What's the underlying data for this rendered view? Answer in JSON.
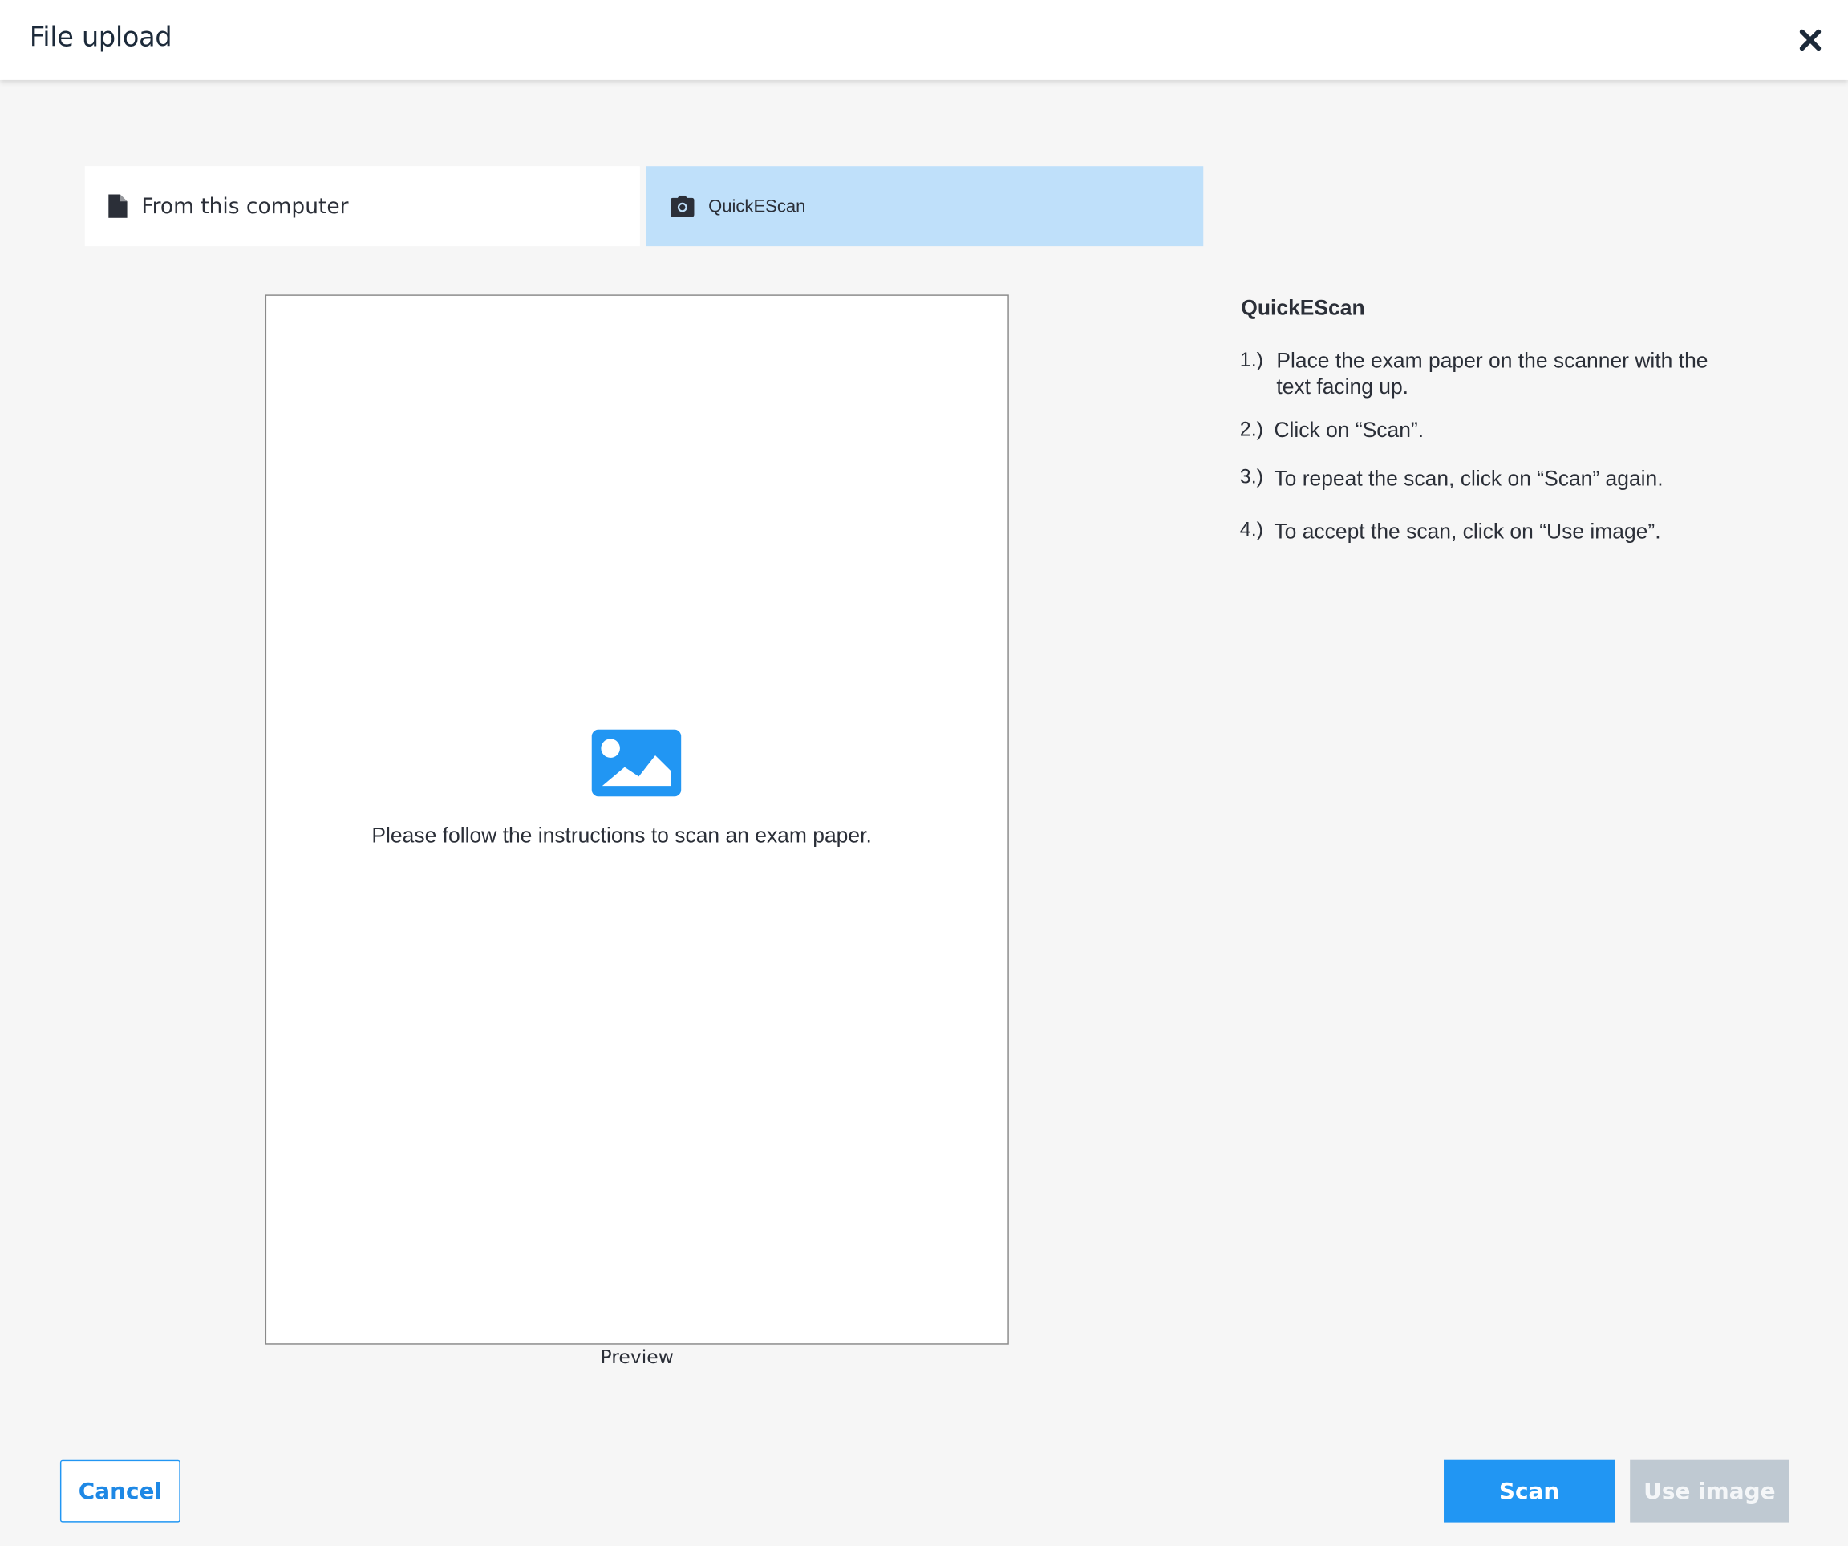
{
  "header": {
    "title": "File upload",
    "close_icon": "close-icon"
  },
  "tabs": [
    {
      "label": "From this computer",
      "icon": "file-icon",
      "active": false
    },
    {
      "label": "QuickEScan",
      "icon": "camera-icon",
      "active": true
    }
  ],
  "preview": {
    "icon": "image-placeholder-icon",
    "message": "Please follow the instructions to scan an exam paper.",
    "caption": "Preview"
  },
  "instructions": {
    "title": "QuickEScan",
    "steps": [
      {
        "num": "1.)",
        "text": "Place the exam paper on the scanner with the text facing up."
      },
      {
        "num": "2.)",
        "text": "Click on “Scan”."
      },
      {
        "num": "3.)",
        "text": "To repeat the scan, click on “Scan” again."
      },
      {
        "num": "4.)",
        "text": "To accept the scan, click on “Use image”."
      }
    ]
  },
  "footer": {
    "cancel_label": "Cancel",
    "scan_label": "Scan",
    "use_image_label": "Use image",
    "use_image_disabled": true
  },
  "colors": {
    "accent": "#2196f3",
    "active_tab": "#bfe0fa",
    "disabled_button": "#bfc9d2",
    "background": "#f6f6f6"
  }
}
